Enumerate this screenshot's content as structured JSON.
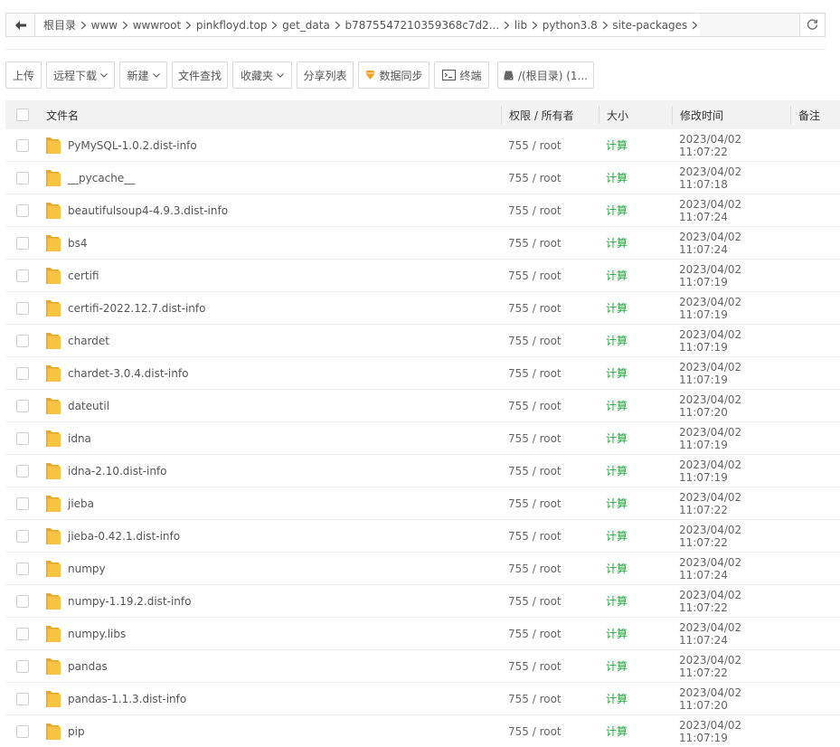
{
  "pathbar": {
    "crumbs": [
      "根目录",
      "www",
      "wwwroot",
      "pinkfloyd.top",
      "get_data",
      "b7875547210359368c7d2...",
      "lib",
      "python3.8",
      "site-packages"
    ]
  },
  "toolbar": {
    "upload": "上传",
    "remote_download": "远程下载",
    "new": "新建",
    "file_search": "文件查找",
    "favorites": "收藏夹",
    "share_list": "分享列表",
    "data_sync": "数据同步",
    "terminal": "终端",
    "disk": "/(根目录) (1..."
  },
  "table": {
    "headers": {
      "name": "文件名",
      "perm": "权限 / 所有者",
      "size": "大小",
      "mtime": "修改时间",
      "note": "备注"
    },
    "rows": [
      {
        "name": "PyMySQL-1.0.2.dist-info",
        "perm": "755 / root",
        "size": "计算",
        "mtime": "2023/04/02 11:07:22"
      },
      {
        "name": "__pycache__",
        "perm": "755 / root",
        "size": "计算",
        "mtime": "2023/04/02 11:07:18"
      },
      {
        "name": "beautifulsoup4-4.9.3.dist-info",
        "perm": "755 / root",
        "size": "计算",
        "mtime": "2023/04/02 11:07:24"
      },
      {
        "name": "bs4",
        "perm": "755 / root",
        "size": "计算",
        "mtime": "2023/04/02 11:07:24"
      },
      {
        "name": "certifi",
        "perm": "755 / root",
        "size": "计算",
        "mtime": "2023/04/02 11:07:19"
      },
      {
        "name": "certifi-2022.12.7.dist-info",
        "perm": "755 / root",
        "size": "计算",
        "mtime": "2023/04/02 11:07:19"
      },
      {
        "name": "chardet",
        "perm": "755 / root",
        "size": "计算",
        "mtime": "2023/04/02 11:07:19"
      },
      {
        "name": "chardet-3.0.4.dist-info",
        "perm": "755 / root",
        "size": "计算",
        "mtime": "2023/04/02 11:07:19"
      },
      {
        "name": "dateutil",
        "perm": "755 / root",
        "size": "计算",
        "mtime": "2023/04/02 11:07:20"
      },
      {
        "name": "idna",
        "perm": "755 / root",
        "size": "计算",
        "mtime": "2023/04/02 11:07:19"
      },
      {
        "name": "idna-2.10.dist-info",
        "perm": "755 / root",
        "size": "计算",
        "mtime": "2023/04/02 11:07:19"
      },
      {
        "name": "jieba",
        "perm": "755 / root",
        "size": "计算",
        "mtime": "2023/04/02 11:07:22"
      },
      {
        "name": "jieba-0.42.1.dist-info",
        "perm": "755 / root",
        "size": "计算",
        "mtime": "2023/04/02 11:07:22"
      },
      {
        "name": "numpy",
        "perm": "755 / root",
        "size": "计算",
        "mtime": "2023/04/02 11:07:24"
      },
      {
        "name": "numpy-1.19.2.dist-info",
        "perm": "755 / root",
        "size": "计算",
        "mtime": "2023/04/02 11:07:22"
      },
      {
        "name": "numpy.libs",
        "perm": "755 / root",
        "size": "计算",
        "mtime": "2023/04/02 11:07:24"
      },
      {
        "name": "pandas",
        "perm": "755 / root",
        "size": "计算",
        "mtime": "2023/04/02 11:07:22"
      },
      {
        "name": "pandas-1.1.3.dist-info",
        "perm": "755 / root",
        "size": "计算",
        "mtime": "2023/04/02 11:07:20"
      },
      {
        "name": "pip",
        "perm": "755 / root",
        "size": "计算",
        "mtime": "2023/04/02 11:07:19"
      }
    ]
  },
  "icons": {
    "back": "arrow-left-icon",
    "refresh": "refresh-icon",
    "caret": "chevron-down-icon",
    "data_sync": "gem-icon",
    "terminal": "terminal-icon",
    "disk": "hard-drive-icon",
    "folder": "folder-icon",
    "crumb_sep": "chevron-right-icon"
  },
  "colors": {
    "calc_link": "#20a53a",
    "folder": "#f6c343",
    "data_sync_icon": "#f0a020"
  }
}
